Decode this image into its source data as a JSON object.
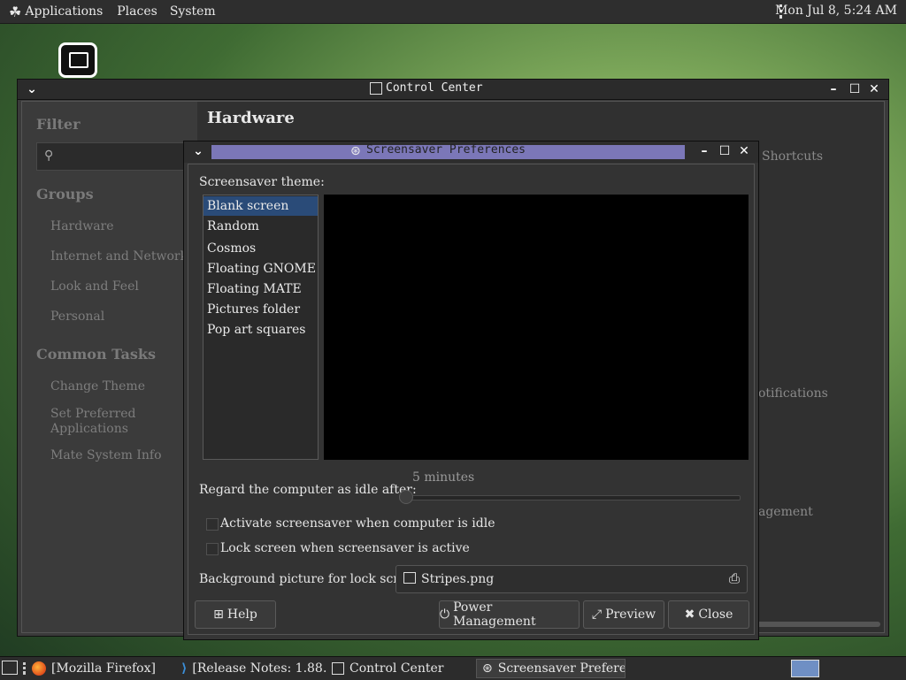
{
  "top_panel": {
    "menus": [
      "Applications",
      "Places",
      "System"
    ],
    "clock": "Mon Jul  8,  5:24 AM"
  },
  "control_center": {
    "title": "Control Center",
    "filter_label": "Filter",
    "groups_label": "Groups",
    "groups": [
      "Hardware",
      "Internet and Network",
      "Look and Feel",
      "Personal"
    ],
    "common_tasks_label": "Common Tasks",
    "tasks": [
      "Change Theme",
      "Set Preferred Applications",
      "Mate System Info"
    ],
    "heading": "Hardware",
    "partial_items": [
      "Shortcuts",
      "otifications",
      "agement"
    ]
  },
  "screensaver": {
    "title": "Screensaver Preferences",
    "theme_label": "Screensaver theme:",
    "themes": [
      "Blank screen",
      "Random",
      "Cosmos",
      "Floating GNOME",
      "Floating MATE",
      "Pictures folder",
      "Pop art squares"
    ],
    "selected_theme": "Blank screen",
    "idle_label": "Regard the computer as idle after:",
    "idle_value": "5 minutes",
    "idle_fraction": 0.0,
    "activate_label": "Activate screensaver when computer is idle",
    "lock_label": "Lock screen when screensaver is active",
    "bg_label": "Background picture for lock screen:",
    "bg_file": "Stripes.png",
    "buttons": {
      "help": "Help",
      "power": "Power Management",
      "preview": "Preview",
      "close": "Close"
    }
  },
  "taskbar": {
    "tasks": [
      "[Mozilla Firefox]",
      "[Release Notes: 1.88…",
      "Control Center",
      "Screensaver Preferen…"
    ]
  }
}
